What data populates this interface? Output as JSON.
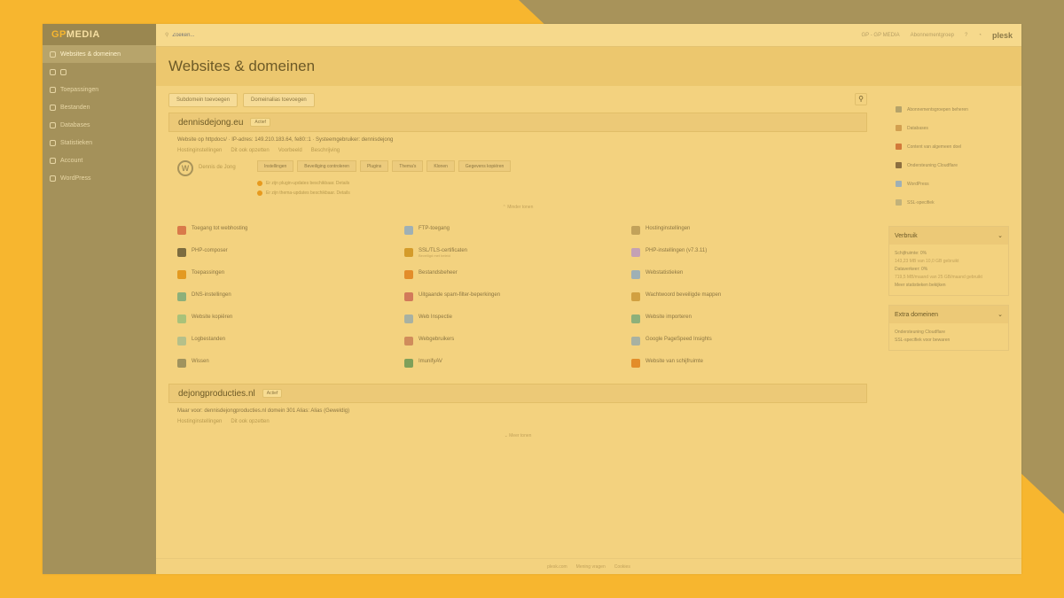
{
  "colors": {
    "brand": "#f7b62f",
    "sidebar": "#a4915a",
    "warning": "#e79a1e"
  },
  "logo": {
    "mark": "GP",
    "text": "MEDIA"
  },
  "sidebar": {
    "items": [
      {
        "label": "Websites & domeinen",
        "icon": "globe-icon",
        "active": true
      },
      {
        "label": "",
        "icon": "hosting-icon"
      },
      {
        "label": "Toepassingen",
        "icon": "apps-icon"
      },
      {
        "label": "Bestanden",
        "icon": "folder-icon"
      },
      {
        "label": "Databases",
        "icon": "database-icon"
      },
      {
        "label": "Statistieken",
        "icon": "chart-icon"
      },
      {
        "label": "Account",
        "icon": "user-icon"
      },
      {
        "label": "WordPress",
        "icon": "wordpress-icon"
      }
    ]
  },
  "topbar": {
    "search_placeholder": "Zoeken...",
    "user": "GP - GP MEDIA",
    "subscription": "Abonnementgroep",
    "plesk": "plesk"
  },
  "page": {
    "title": "Websites & domeinen"
  },
  "toolbar": {
    "add_domain": "Subdomein toevoegen",
    "add_alias": "Domeinalias toevoegen"
  },
  "domain1": {
    "name": "dennisdejong.eu",
    "badge": "Actief",
    "info": "Website op httpdocs/ · IP-adres: 149.210.183.64, fe80::1 · Systeemgebruiker: dennisdejong",
    "links": [
      "Hostinginstellingen",
      "Dit ook opzetten",
      "Voorbeeld",
      "Beschrijving"
    ],
    "wp": {
      "label": "Dennis de Jong",
      "buttons": [
        "Instellingen",
        "Beveiliging controleren",
        "Plugins",
        "Thema's",
        "Klonen",
        "Gegevens kopiëren"
      ],
      "warn1": "Er zijn plugin-updates beschikbaar. Details",
      "warn2": "Er zijn thema-updates beschikbaar. Details"
    },
    "toggle": "⌃ Minder tonen",
    "features": [
      {
        "label": "Toegang tot webhosting",
        "color": "#d97a4a"
      },
      {
        "label": "FTP-toegang",
        "color": "#9fb0b5"
      },
      {
        "label": "Hostinginstellingen",
        "color": "#c2a25a"
      },
      {
        "label": "PHP-composer",
        "color": "#7c6c3f"
      },
      {
        "label": "SSL/TLS-certificaten",
        "sub": "Beveiligd met beleid",
        "color": "#d49b2a"
      },
      {
        "label": "PHP-instellingen (v7.3.11)",
        "color": "#c4a1b4"
      },
      {
        "label": "Toepassingen",
        "color": "#e39a21"
      },
      {
        "label": "Bestandsbeheer",
        "color": "#e38d2a"
      },
      {
        "label": "Webstatistieken",
        "color": "#9fb0b5"
      },
      {
        "label": "DNS-instellingen",
        "color": "#8db07a"
      },
      {
        "label": "Uitgaande spam-filter-beperkingen",
        "color": "#d27a5a"
      },
      {
        "label": "Wachtwoord beveiligde mappen",
        "color": "#d1a041"
      },
      {
        "label": "Website kopiëren",
        "color": "#a9c27a"
      },
      {
        "label": "Web Inspectie",
        "color": "#a8b1a2"
      },
      {
        "label": "Website importeren",
        "color": "#8db07a"
      },
      {
        "label": "Logbestanden",
        "color": "#b5c08a"
      },
      {
        "label": "Webgebruikers",
        "color": "#d08c5b"
      },
      {
        "label": "Google PageSpeed Insights",
        "color": "#a8b1a2"
      },
      {
        "label": "Wissen",
        "color": "#a0935e"
      },
      {
        "label": "ImunifyAV",
        "color": "#7fa05a"
      },
      {
        "label": "Website van schijfruimte",
        "color": "#e38d2a"
      }
    ]
  },
  "domain2": {
    "name": "dejongproducties.nl",
    "badge": "Actief",
    "desc": "Maar voor: dennisdejongproducties.nl domein 301 Alias: Alias (Geweldig)",
    "links": [
      "Hostinginstellingen",
      "Dit ook opzetten"
    ],
    "toggle": "⌄ Meer tonen"
  },
  "right": {
    "links": [
      {
        "label": "Abonnementsgroepen beheren",
        "color": "#b5a36a"
      },
      {
        "label": "Databases",
        "color": "#d2a050"
      },
      {
        "label": "Content van algemeen doel",
        "color": "#d27a3a"
      },
      {
        "label": "Ondersteuning Cloudflare",
        "color": "#8c6f3f"
      },
      {
        "label": "WordPress",
        "color": "#9fb0b5"
      },
      {
        "label": "SSL-specifiek",
        "color": "#c2b27a"
      }
    ],
    "usage": {
      "title": "Verbruik",
      "lines": [
        "Schijfruimte: 0%",
        "143,23 MB van 10,0 GB gebruikt",
        "Dataverkeer: 0%",
        "719,5 MB/maand van 25 GB/maand gebruikt"
      ],
      "link": "Meer statistieken bekijken"
    },
    "extra": {
      "title": "Extra domeinen",
      "links": [
        "Ondersteuning Cloudflare",
        "SSL-specifiek voor bewaren"
      ]
    }
  },
  "footer": {
    "links": [
      "plesk.com",
      "Mening vragen",
      "Cookies"
    ]
  }
}
